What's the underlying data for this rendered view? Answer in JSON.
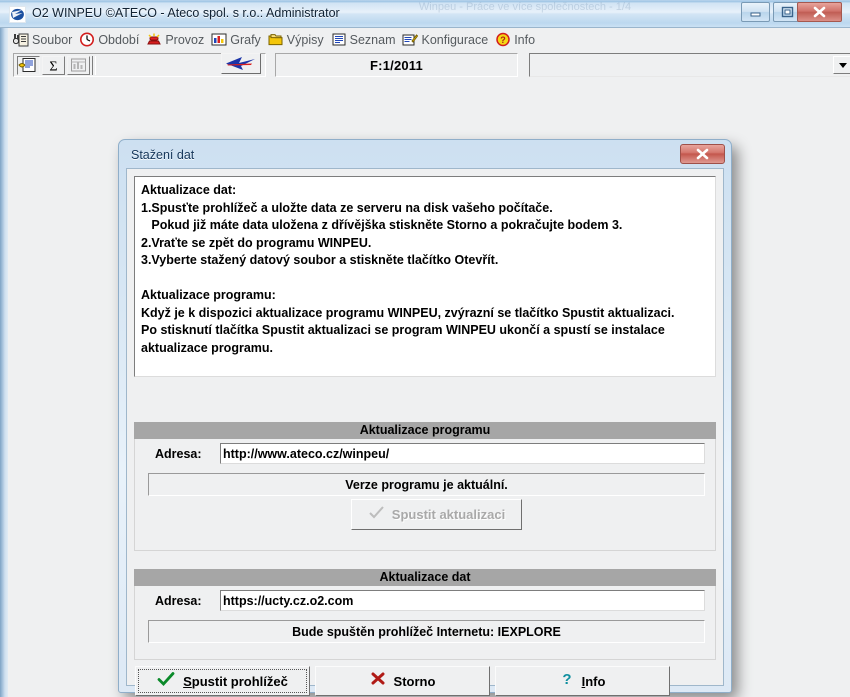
{
  "window": {
    "title": "O2 WINPEU  ©ATECO - Ateco spol. s r.o.: Administrator",
    "ghost_title": "Winpeu - Práce ve více společnostech - 1/4",
    "icon": "app-logo-icon",
    "controls": {
      "minimize": "minimize-icon",
      "maximize": "maximize-icon",
      "close": "close-icon"
    }
  },
  "menubar": {
    "items": [
      {
        "label": "Soubor",
        "icon": "binoculars-clipboard-icon"
      },
      {
        "label": "Období",
        "icon": "clock-icon"
      },
      {
        "label": "Provoz",
        "icon": "telephone-icon"
      },
      {
        "label": "Grafy",
        "icon": "bar-chart-icon"
      },
      {
        "label": "Výpisy",
        "icon": "folders-icon"
      },
      {
        "label": "Seznam",
        "icon": "list-document-icon"
      },
      {
        "label": "Konfigurace",
        "icon": "settings-pen-icon"
      },
      {
        "label": "Info",
        "icon": "question-ball-icon"
      }
    ]
  },
  "toolbar": {
    "buttons": [
      {
        "name": "report-icon",
        "state": "pressed"
      },
      {
        "name": "sum-sigma-icon",
        "state": "normal"
      },
      {
        "name": "table-chart-icon",
        "state": "disabled"
      }
    ],
    "arrow_button": "blue-red-arrow-left-icon",
    "period_value": "F:1/2011",
    "company_combo": {
      "value": "",
      "placeholder": ""
    }
  },
  "dialog": {
    "title": "Stažení dat",
    "close_icon": "close-icon",
    "instructions": [
      "Aktualizace dat:",
      "1.Spusťte prohlížeč a uložte data ze serveru na disk vašeho počítače.",
      "   Pokud již máte data uložena z dřívějška stiskněte Storno a pokračujte bodem 3.",
      "2.Vraťte se zpět do programu WINPEU.",
      "3.Vyberte stažený datový soubor a stiskněte tlačítko Otevřít.",
      "",
      "Aktualizace programu:",
      "Když je k dispozici aktualizace programu WINPEU, zvýrazní se tlačítko Spustit aktualizaci.",
      "Po stisknutí tlačítka Spustit aktualizaci se program WINPEU ukončí a spustí se instalace",
      "aktualizace programu."
    ],
    "program_group": {
      "header": "Aktualizace programu",
      "address_label": "Adresa:",
      "address_value": "http://www.ateco.cz/winpeu/",
      "status": "Verze programu je aktuální.",
      "update_button": {
        "label": "Spustit aktualizaci",
        "accesskey_char": "S",
        "icon": "check-mark-icon",
        "enabled": false
      }
    },
    "data_group": {
      "header": "Aktualizace dat",
      "address_label": "Adresa:",
      "address_value": "https://ucty.cz.o2.com",
      "status": "Bude spuštěn prohlížeč Internetu:  IEXPLORE"
    },
    "buttons": [
      {
        "label": "Spustit prohlížeč",
        "icon": "green-check-icon",
        "focused": true,
        "accesskey": "S"
      },
      {
        "label": "Storno",
        "icon": "red-x-icon",
        "focused": false,
        "accesskey": ""
      },
      {
        "label": "Info",
        "icon": "teal-question-icon",
        "focused": false,
        "accesskey": "I"
      }
    ]
  },
  "colors": {
    "window_face": "#eff0f1",
    "group_strip": "#a6a6a6",
    "aero_blue": "#cde0f1",
    "close_red": "#c4574d",
    "check_green": "#0a8a2a",
    "x_red": "#b01a16",
    "question_teal": "#0f8f9f",
    "disabled_gray": "#a9a9a9"
  }
}
